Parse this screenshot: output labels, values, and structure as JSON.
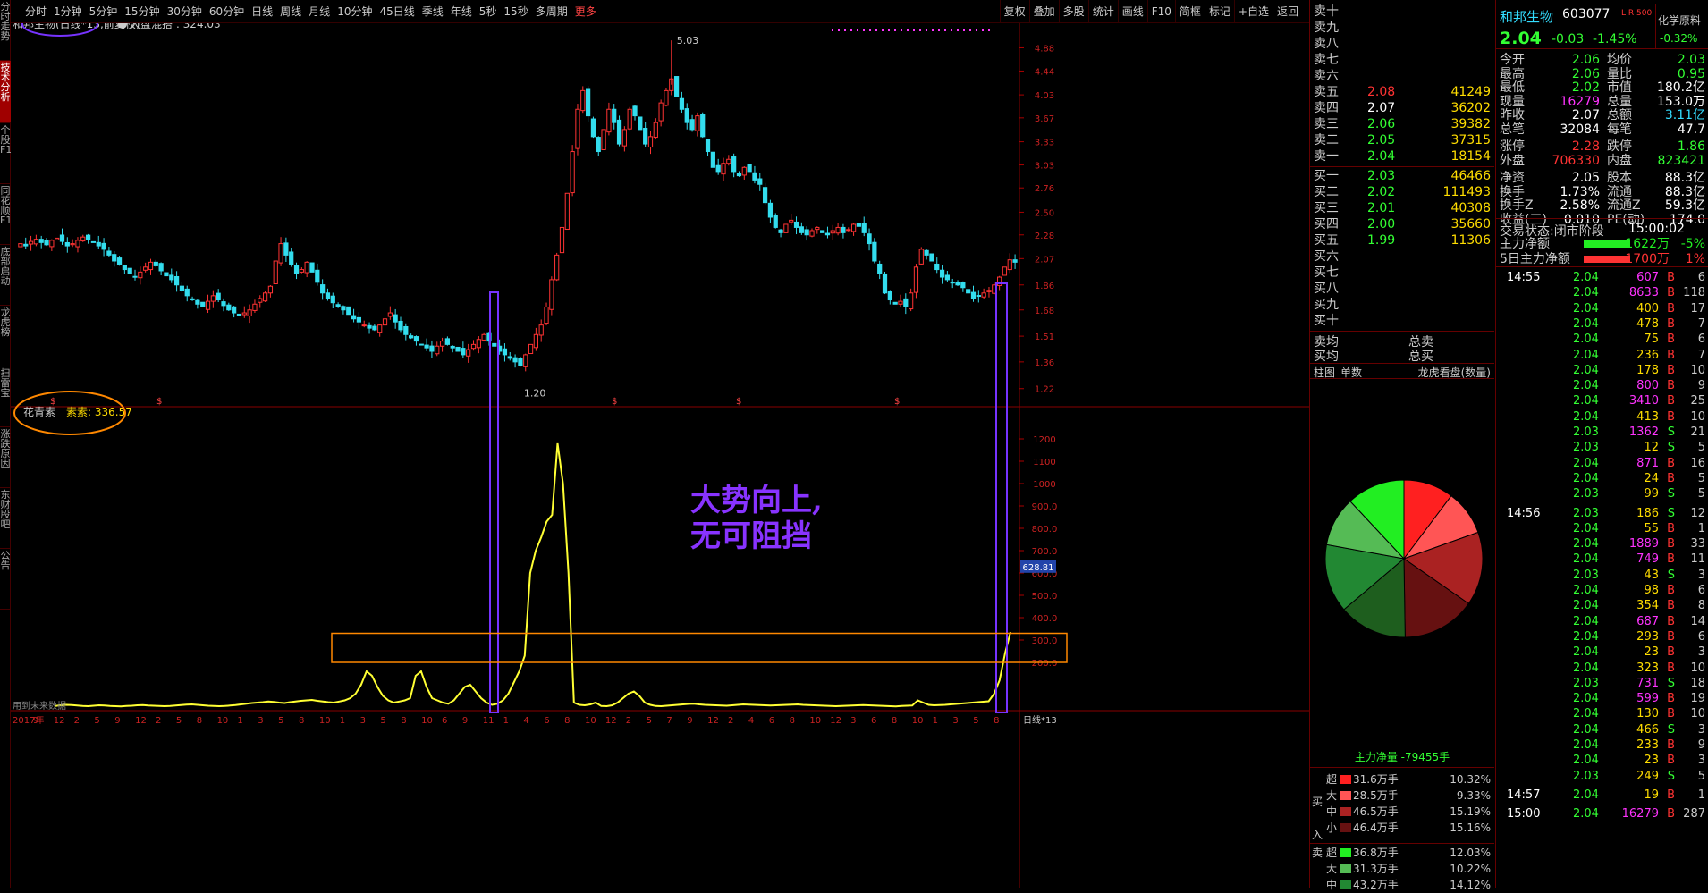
{
  "left_tabs": [
    "分时走势",
    "技术分析",
    "个股F10",
    "同花顺F10",
    "底部启动",
    "龙虎榜",
    "扫雷宝",
    "涨跌原因",
    "东财股吧",
    "公告"
  ],
  "toolbar": {
    "periods": [
      "分时",
      "1分钟",
      "5分钟",
      "15分钟",
      "30分钟",
      "60分钟",
      "日线",
      "周线",
      "月线",
      "10分钟",
      "45日线",
      "季线",
      "年线",
      "5秒",
      "15秒",
      "多周期"
    ],
    "more": "更多",
    "tools": [
      "复权",
      "叠加",
      "多股",
      "统计",
      "画线",
      "F10",
      "简框",
      "标记",
      "+自选",
      "返回"
    ]
  },
  "chart_info": {
    "title": "和邦生物(日线*13,前复权)",
    "market_label": "大盘混搭",
    "market_value": "324.03",
    "indicator_name": "花青素",
    "indicator_sub": "素素",
    "indicator_value": "336.57",
    "future_data_note": "用到未来数据",
    "period_label": "日线*13",
    "annotation": [
      "大势向上,",
      "无可阻挡"
    ],
    "max_label": "5.03",
    "min_label": "1.20",
    "current_indicator": "628.81"
  },
  "chart_data": [
    {
      "type": "candlestick",
      "y_ticks": [
        "4.88",
        "4.44",
        "4.03",
        "3.67",
        "3.33",
        "3.03",
        "2.76",
        "2.50",
        "2.28",
        "2.07",
        "1.86",
        "1.68",
        "1.51",
        "1.36",
        "1.22"
      ],
      "log_scale": true,
      "ylim": [
        1.15,
        5.2
      ],
      "x_ticks": [
        "2017年",
        "9",
        "12",
        "2",
        "5",
        "9",
        "12",
        "2",
        "5",
        "8",
        "10",
        "1",
        "3",
        "5",
        "8",
        "10",
        "1",
        "3",
        "5",
        "8",
        "10",
        "6",
        "9",
        "11",
        "1",
        "4",
        "6",
        "8",
        "10",
        "12",
        "2",
        "5",
        "7",
        "9",
        "12",
        "2",
        "4",
        "6",
        "8",
        "10",
        "12",
        "3",
        "6",
        "8",
        "10",
        "1",
        "3",
        "5",
        "8"
      ],
      "closes": [
        2.2,
        2.18,
        2.22,
        2.24,
        2.21,
        2.19,
        2.23,
        2.25,
        2.22,
        2.18,
        2.2,
        2.23,
        2.26,
        2.24,
        2.21,
        2.18,
        2.15,
        2.1,
        2.05,
        2.02,
        1.98,
        1.95,
        1.92,
        1.96,
        2.0,
        2.04,
        2.01,
        1.97,
        1.93,
        1.9,
        1.86,
        1.82,
        1.78,
        1.75,
        1.72,
        1.7,
        1.74,
        1.78,
        1.75,
        1.71,
        1.68,
        1.66,
        1.64,
        1.66,
        1.68,
        1.72,
        1.76,
        1.8,
        1.85,
        2.05,
        2.2,
        2.1,
        2.02,
        1.95,
        1.98,
        2.04,
        1.96,
        1.88,
        1.8,
        1.76,
        1.73,
        1.7,
        1.68,
        1.65,
        1.62,
        1.6,
        1.58,
        1.56,
        1.55,
        1.58,
        1.62,
        1.66,
        1.6,
        1.55,
        1.52,
        1.5,
        1.48,
        1.46,
        1.44,
        1.42,
        1.45,
        1.48,
        1.46,
        1.44,
        1.42,
        1.4,
        1.43,
        1.46,
        1.49,
        1.52,
        1.48,
        1.45,
        1.42,
        1.4,
        1.38,
        1.36,
        1.34,
        1.4,
        1.46,
        1.52,
        1.58,
        1.7,
        1.9,
        2.1,
        2.35,
        2.7,
        3.2,
        3.8,
        4.1,
        3.7,
        3.4,
        3.2,
        3.5,
        3.8,
        3.6,
        3.3,
        3.5,
        3.8,
        3.7,
        3.5,
        3.3,
        3.4,
        3.6,
        3.9,
        4.1,
        4.3,
        4.0,
        3.8,
        3.6,
        3.5,
        3.7,
        3.4,
        3.2,
        3.0,
        2.95,
        3.05,
        3.1,
        2.95,
        2.9,
        3.0,
        2.95,
        2.85,
        2.8,
        2.6,
        2.45,
        2.35,
        2.3,
        2.38,
        2.42,
        2.35,
        2.3,
        2.28,
        2.32,
        2.35,
        2.3,
        2.28,
        2.32,
        2.35,
        2.3,
        2.33,
        2.38,
        2.36,
        2.3,
        2.2,
        2.05,
        1.95,
        1.8,
        1.75,
        1.72,
        1.74,
        1.7,
        1.8,
        2.0,
        2.15,
        2.1,
        2.05,
        1.98,
        1.92,
        1.9,
        1.88,
        1.86,
        1.84,
        1.8,
        1.76,
        1.78,
        1.8,
        1.82,
        1.86,
        1.92,
        2.0,
        2.06,
        2.04
      ]
    },
    {
      "type": "line",
      "y_ticks": [
        "1200",
        "1100",
        "1000",
        "900.0",
        "800.0",
        "700.0",
        "600.0",
        "500.0",
        "400.0",
        "300.0",
        "200.0"
      ],
      "ylim": [
        0,
        1300
      ],
      "values": [
        5,
        8,
        10,
        9,
        7,
        5,
        4,
        6,
        8,
        7,
        5,
        4,
        3,
        5,
        6,
        8,
        9,
        7,
        6,
        5,
        4,
        5,
        7,
        9,
        11,
        12,
        10,
        8,
        6,
        5,
        4,
        5,
        7,
        9,
        12,
        15,
        18,
        20,
        22,
        25,
        23,
        20,
        18,
        22,
        25,
        28,
        30,
        32,
        28,
        25,
        22,
        20,
        25,
        30,
        40,
        60,
        100,
        160,
        140,
        90,
        50,
        30,
        20,
        25,
        30,
        40,
        140,
        160,
        90,
        40,
        30,
        20,
        15,
        30,
        60,
        90,
        100,
        70,
        40,
        20,
        10,
        15,
        30,
        60,
        110,
        160,
        230,
        600,
        700,
        760,
        830,
        860,
        1180,
        1000,
        600,
        20,
        10,
        8,
        12,
        20,
        5,
        4,
        8,
        20,
        40,
        60,
        70,
        50,
        20,
        10,
        5,
        4,
        6,
        8,
        10,
        12,
        14,
        15,
        12,
        10,
        9,
        8,
        7,
        6,
        8,
        10,
        12,
        11,
        10,
        9,
        8,
        7,
        8,
        9,
        10,
        11,
        12,
        10,
        9,
        8,
        7,
        6,
        5,
        4,
        5,
        6,
        7,
        8,
        9,
        8,
        7,
        6,
        5,
        4,
        3,
        5,
        6,
        7,
        30,
        20,
        10,
        8,
        9,
        10,
        12,
        14,
        16,
        18,
        20,
        22,
        24,
        26,
        60,
        120,
        240,
        336
      ]
    }
  ],
  "stock": {
    "name": "和邦生物",
    "code": "603077",
    "tag": "L R 500",
    "price": "2.04",
    "change": "-0.03",
    "pct": "-1.45%",
    "sector": "化学原料",
    "sector_pct": "-0.32%"
  },
  "sell_orders": [
    {
      "label": "卖十",
      "price": "",
      "vol": ""
    },
    {
      "label": "卖九",
      "price": "",
      "vol": ""
    },
    {
      "label": "卖八",
      "price": "",
      "vol": ""
    },
    {
      "label": "卖七",
      "price": "",
      "vol": ""
    },
    {
      "label": "卖六",
      "price": "",
      "vol": ""
    },
    {
      "label": "卖五",
      "price": "2.08",
      "vol": "41249"
    },
    {
      "label": "卖四",
      "price": "2.07",
      "vol": "36202"
    },
    {
      "label": "卖三",
      "price": "2.06",
      "vol": "39382"
    },
    {
      "label": "卖二",
      "price": "2.05",
      "vol": "37315"
    },
    {
      "label": "卖一",
      "price": "2.04",
      "vol": "18154"
    }
  ],
  "buy_orders": [
    {
      "label": "买一",
      "price": "2.03",
      "vol": "46466"
    },
    {
      "label": "买二",
      "price": "2.02",
      "vol": "111493"
    },
    {
      "label": "买三",
      "price": "2.01",
      "vol": "40308"
    },
    {
      "label": "买四",
      "price": "2.00",
      "vol": "35660"
    },
    {
      "label": "买五",
      "price": "1.99",
      "vol": "11306"
    },
    {
      "label": "买六",
      "price": "",
      "vol": ""
    },
    {
      "label": "买七",
      "price": "",
      "vol": ""
    },
    {
      "label": "买八",
      "price": "",
      "vol": ""
    },
    {
      "label": "买九",
      "price": "",
      "vol": ""
    },
    {
      "label": "买十",
      "price": "",
      "vol": ""
    }
  ],
  "avg": {
    "sell_label": "卖均",
    "buy_label": "买均",
    "sell_total": "总卖",
    "buy_total": "总买"
  },
  "panel_tabs": [
    "柱图",
    "单数",
    "龙虎看盘(数量)"
  ],
  "main_net": "主力净量 -79455手",
  "flow": {
    "buy_label": "买入",
    "sell_label": "卖",
    "buy": [
      {
        "k": "超",
        "v": "31.6万手",
        "p": "10.32%",
        "c": "#ff2020"
      },
      {
        "k": "大",
        "v": "28.5万手",
        "p": "9.33%",
        "c": "#ff5555"
      },
      {
        "k": "中",
        "v": "46.5万手",
        "p": "15.19%",
        "c": "#aa2222"
      },
      {
        "k": "小",
        "v": "46.4万手",
        "p": "15.16%",
        "c": "#661111"
      }
    ],
    "sell": [
      {
        "k": "超",
        "v": "36.8万手",
        "p": "12.03%",
        "c": "#22ee22"
      },
      {
        "k": "大",
        "v": "31.3万手",
        "p": "10.22%",
        "c": "#55bb55"
      },
      {
        "k": "中",
        "v": "43.2万手",
        "p": "14.12%",
        "c": "#228833"
      }
    ]
  },
  "pie": [
    {
      "v": 10.32,
      "c": "#ff2020"
    },
    {
      "v": 9.33,
      "c": "#ff5555"
    },
    {
      "v": 15.19,
      "c": "#aa2222"
    },
    {
      "v": 15.16,
      "c": "#661111"
    },
    {
      "v": 14.12,
      "c": "#1e5e1e"
    },
    {
      "v": 14.12,
      "c": "#228833"
    },
    {
      "v": 10.22,
      "c": "#55bb55"
    },
    {
      "v": 12.03,
      "c": "#22ee22"
    }
  ],
  "stats": [
    {
      "k1": "今开",
      "v1": "2.06",
      "c1": "grn",
      "k2": "均价",
      "v2": "2.03",
      "c2": "grn"
    },
    {
      "k1": "最高",
      "v1": "2.06",
      "c1": "grn",
      "k2": "量比",
      "v2": "0.95",
      "c2": "grn"
    },
    {
      "k1": "最低",
      "v1": "2.02",
      "c1": "grn",
      "k2": "市值",
      "v2": "180.2亿",
      "c2": "wht"
    },
    {
      "k1": "现量",
      "v1": "16279",
      "c1": "mag",
      "k2": "总量",
      "v2": "153.0万",
      "c2": "wht"
    },
    {
      "k1": "昨收",
      "v1": "2.07",
      "c1": "wht",
      "k2": "总额",
      "v2": "3.11亿",
      "c2": "cyn"
    },
    {
      "k1": "总笔",
      "v1": "32084",
      "c1": "wht",
      "k2": "每笔",
      "v2": "47.7",
      "c2": "wht"
    },
    {
      "k1": "涨停",
      "v1": "2.28",
      "c1": "red",
      "k2": "跌停",
      "v2": "1.86",
      "c2": "grn"
    },
    {
      "k1": "外盘",
      "v1": "706330",
      "c1": "red",
      "k2": "内盘",
      "v2": "823421",
      "c2": "grn"
    },
    {
      "k1": "净资",
      "v1": "2.05",
      "c1": "wht",
      "k2": "股本",
      "v2": "88.3亿",
      "c2": "wht"
    },
    {
      "k1": "换手",
      "v1": "1.73%",
      "c1": "wht",
      "k2": "流通",
      "v2": "88.3亿",
      "c2": "wht"
    },
    {
      "k1": "换手Z",
      "v1": "2.58%",
      "c1": "wht",
      "k2": "流通Z",
      "v2": "59.3亿",
      "c2": "wht"
    },
    {
      "k1": "收益(三)",
      "v1": "0.010",
      "c1": "wht",
      "k2": "PE(动)",
      "v2": "174.0",
      "c2": "wht"
    }
  ],
  "trade_status": {
    "label": "交易状态:闭市阶段",
    "time": "15:00:02"
  },
  "mainflow": [
    {
      "label": "主力净额",
      "value": "-1622万",
      "pct": "-5%",
      "color": "#22ee22"
    },
    {
      "label": "5日主力净额",
      "value": "1700万",
      "pct": "1%",
      "color": "#ff3333"
    }
  ],
  "ticks": [
    {
      "t": "14:55",
      "p": "2.04",
      "v": "607",
      "d": "B",
      "c": "6"
    },
    {
      "t": "",
      "p": "2.04",
      "v": "8633",
      "d": "B",
      "c": "118"
    },
    {
      "t": "",
      "p": "2.04",
      "v": "400",
      "d": "B",
      "c": "17"
    },
    {
      "t": "",
      "p": "2.04",
      "v": "478",
      "d": "B",
      "c": "7"
    },
    {
      "t": "",
      "p": "2.04",
      "v": "75",
      "d": "B",
      "c": "6"
    },
    {
      "t": "",
      "p": "2.04",
      "v": "236",
      "d": "B",
      "c": "7"
    },
    {
      "t": "",
      "p": "2.04",
      "v": "178",
      "d": "B",
      "c": "10"
    },
    {
      "t": "",
      "p": "2.04",
      "v": "800",
      "d": "B",
      "c": "9"
    },
    {
      "t": "",
      "p": "2.04",
      "v": "3410",
      "d": "B",
      "c": "25"
    },
    {
      "t": "",
      "p": "2.04",
      "v": "413",
      "d": "B",
      "c": "10"
    },
    {
      "t": "",
      "p": "2.03",
      "v": "1362",
      "d": "S",
      "c": "21"
    },
    {
      "t": "",
      "p": "2.03",
      "v": "12",
      "d": "S",
      "c": "5"
    },
    {
      "t": "",
      "p": "2.04",
      "v": "871",
      "d": "B",
      "c": "16"
    },
    {
      "t": "",
      "p": "2.04",
      "v": "24",
      "d": "B",
      "c": "5"
    },
    {
      "t": "",
      "p": "2.03",
      "v": "99",
      "d": "S",
      "c": "5"
    },
    {
      "t": "14:56",
      "p": "2.03",
      "v": "186",
      "d": "S",
      "c": "12"
    },
    {
      "t": "",
      "p": "2.04",
      "v": "55",
      "d": "B",
      "c": "1"
    },
    {
      "t": "",
      "p": "2.04",
      "v": "1889",
      "d": "B",
      "c": "33"
    },
    {
      "t": "",
      "p": "2.04",
      "v": "749",
      "d": "B",
      "c": "11"
    },
    {
      "t": "",
      "p": "2.03",
      "v": "43",
      "d": "S",
      "c": "3"
    },
    {
      "t": "",
      "p": "2.04",
      "v": "98",
      "d": "B",
      "c": "6"
    },
    {
      "t": "",
      "p": "2.04",
      "v": "354",
      "d": "B",
      "c": "8"
    },
    {
      "t": "",
      "p": "2.04",
      "v": "687",
      "d": "B",
      "c": "14"
    },
    {
      "t": "",
      "p": "2.04",
      "v": "293",
      "d": "B",
      "c": "6"
    },
    {
      "t": "",
      "p": "2.04",
      "v": "23",
      "d": "B",
      "c": "3"
    },
    {
      "t": "",
      "p": "2.04",
      "v": "323",
      "d": "B",
      "c": "10"
    },
    {
      "t": "",
      "p": "2.03",
      "v": "731",
      "d": "S",
      "c": "18"
    },
    {
      "t": "",
      "p": "2.04",
      "v": "599",
      "d": "B",
      "c": "19"
    },
    {
      "t": "",
      "p": "2.04",
      "v": "130",
      "d": "B",
      "c": "10"
    },
    {
      "t": "",
      "p": "2.04",
      "v": "466",
      "d": "S",
      "c": "3"
    },
    {
      "t": "",
      "p": "2.04",
      "v": "233",
      "d": "B",
      "c": "9"
    },
    {
      "t": "",
      "p": "2.04",
      "v": "23",
      "d": "B",
      "c": "3"
    },
    {
      "t": "",
      "p": "2.03",
      "v": "249",
      "d": "S",
      "c": "5"
    },
    {
      "t": "14:57",
      "p": "2.04",
      "v": "19",
      "d": "B",
      "c": "1"
    },
    {
      "t": "15:00",
      "p": "2.04",
      "v": "16279",
      "d": "B",
      "c": "287"
    }
  ]
}
